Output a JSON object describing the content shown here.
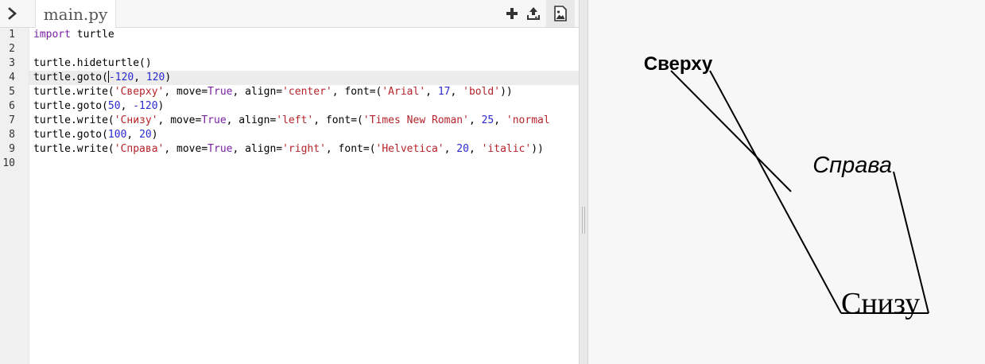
{
  "editor": {
    "file_tab": "main.py",
    "line_numbers": [
      "1",
      "2",
      "3",
      "4",
      "5",
      "6",
      "7",
      "8",
      "9",
      "10"
    ],
    "code": [
      [
        {
          "t": "kw",
          "v": "import"
        },
        {
          "t": "p",
          "v": " turtle"
        }
      ],
      [],
      [
        {
          "t": "p",
          "v": "turtle.hideturtle()"
        }
      ],
      [
        {
          "t": "p",
          "v": "turtle.goto("
        },
        {
          "t": "num",
          "v": "-120"
        },
        {
          "t": "p",
          "v": ", "
        },
        {
          "t": "num",
          "v": "120"
        },
        {
          "t": "p",
          "v": ")"
        }
      ],
      [
        {
          "t": "p",
          "v": "turtle.write("
        },
        {
          "t": "str",
          "v": "'Сверху'"
        },
        {
          "t": "p",
          "v": ", move="
        },
        {
          "t": "kw",
          "v": "True"
        },
        {
          "t": "p",
          "v": ", align="
        },
        {
          "t": "str",
          "v": "'center'"
        },
        {
          "t": "p",
          "v": ", font=("
        },
        {
          "t": "str",
          "v": "'Arial'"
        },
        {
          "t": "p",
          "v": ", "
        },
        {
          "t": "num",
          "v": "17"
        },
        {
          "t": "p",
          "v": ", "
        },
        {
          "t": "str",
          "v": "'bold'"
        },
        {
          "t": "p",
          "v": "))"
        }
      ],
      [
        {
          "t": "p",
          "v": "turtle.goto("
        },
        {
          "t": "num",
          "v": "50"
        },
        {
          "t": "p",
          "v": ", "
        },
        {
          "t": "num",
          "v": "-120"
        },
        {
          "t": "p",
          "v": ")"
        }
      ],
      [
        {
          "t": "p",
          "v": "turtle.write("
        },
        {
          "t": "str",
          "v": "'Снизу'"
        },
        {
          "t": "p",
          "v": ", move="
        },
        {
          "t": "kw",
          "v": "True"
        },
        {
          "t": "p",
          "v": ", align="
        },
        {
          "t": "str",
          "v": "'left'"
        },
        {
          "t": "p",
          "v": ", font=("
        },
        {
          "t": "str",
          "v": "'Times New Roman'"
        },
        {
          "t": "p",
          "v": ", "
        },
        {
          "t": "num",
          "v": "25"
        },
        {
          "t": "p",
          "v": ", "
        },
        {
          "t": "str",
          "v": "'normal"
        }
      ],
      [
        {
          "t": "p",
          "v": "turtle.goto("
        },
        {
          "t": "num",
          "v": "100"
        },
        {
          "t": "p",
          "v": ", "
        },
        {
          "t": "num",
          "v": "20"
        },
        {
          "t": "p",
          "v": ")"
        }
      ],
      [
        {
          "t": "p",
          "v": "turtle.write("
        },
        {
          "t": "str",
          "v": "'Справа'"
        },
        {
          "t": "p",
          "v": ", move="
        },
        {
          "t": "kw",
          "v": "True"
        },
        {
          "t": "p",
          "v": ", align="
        },
        {
          "t": "str",
          "v": "'right'"
        },
        {
          "t": "p",
          "v": ", font=("
        },
        {
          "t": "str",
          "v": "'Helvetica'"
        },
        {
          "t": "p",
          "v": ", "
        },
        {
          "t": "num",
          "v": "20"
        },
        {
          "t": "p",
          "v": ", "
        },
        {
          "t": "str",
          "v": "'italic'"
        },
        {
          "t": "p",
          "v": "))"
        }
      ],
      []
    ],
    "active_line": 4
  },
  "toolbar": {
    "sidebar_toggle_icon": "chevron-right-icon",
    "add_icon": "plus-icon",
    "upload_icon": "upload-icon",
    "image_icon": "image-icon"
  },
  "canvas": {
    "texts": {
      "top": "Сверху",
      "bottom": "Снизу",
      "right": "Справа"
    }
  },
  "colors": {
    "keyword": "#7a1fa2",
    "string": "#b5242a",
    "number": "#2a2ad0",
    "canvas_bg": "#f7f7f7"
  }
}
